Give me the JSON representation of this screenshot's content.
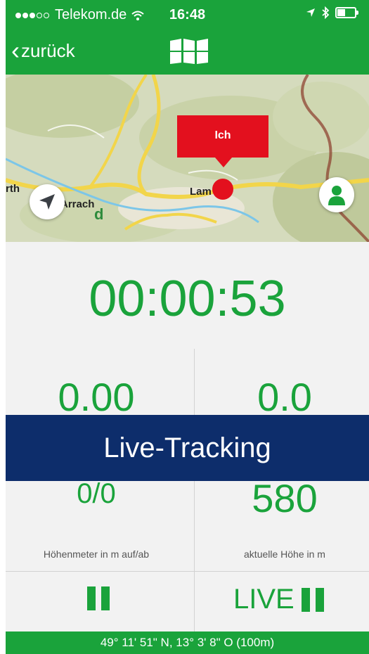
{
  "status_bar": {
    "carrier": "Telekom.de",
    "time": "16:48",
    "signal_icon": "signal-dots-icon",
    "wifi_icon": "wifi-icon",
    "location_icon": "location-arrow-icon",
    "bluetooth_icon": "bluetooth-icon",
    "battery_icon": "battery-icon"
  },
  "nav": {
    "back_label": "zurück",
    "map_icon": "folded-map-icon"
  },
  "map": {
    "marker_label": "Ich",
    "place_labels": [
      "rth",
      "Arrach",
      "Lam",
      "d"
    ],
    "compass_icon": "navigation-arrow-icon",
    "person_icon": "person-icon"
  },
  "tracking": {
    "elapsed_time": "00:00:53",
    "left_value_top": "0.00",
    "right_value_top": "0.0",
    "overlay_label": "Live-Tracking",
    "ascent_descent": "0/0",
    "ascent_caption": "Höhenmeter in m auf/ab",
    "current_altitude": "580",
    "altitude_caption": "aktuelle Höhe in m",
    "live_label": "LIVE"
  },
  "footer": {
    "coordinates": "49° 11' 51\" N, 13° 3' 8\" O (100m)"
  },
  "colors": {
    "brand_green": "#1aa33b",
    "banner_blue": "#0d2d6b",
    "marker_red": "#e3101e"
  }
}
